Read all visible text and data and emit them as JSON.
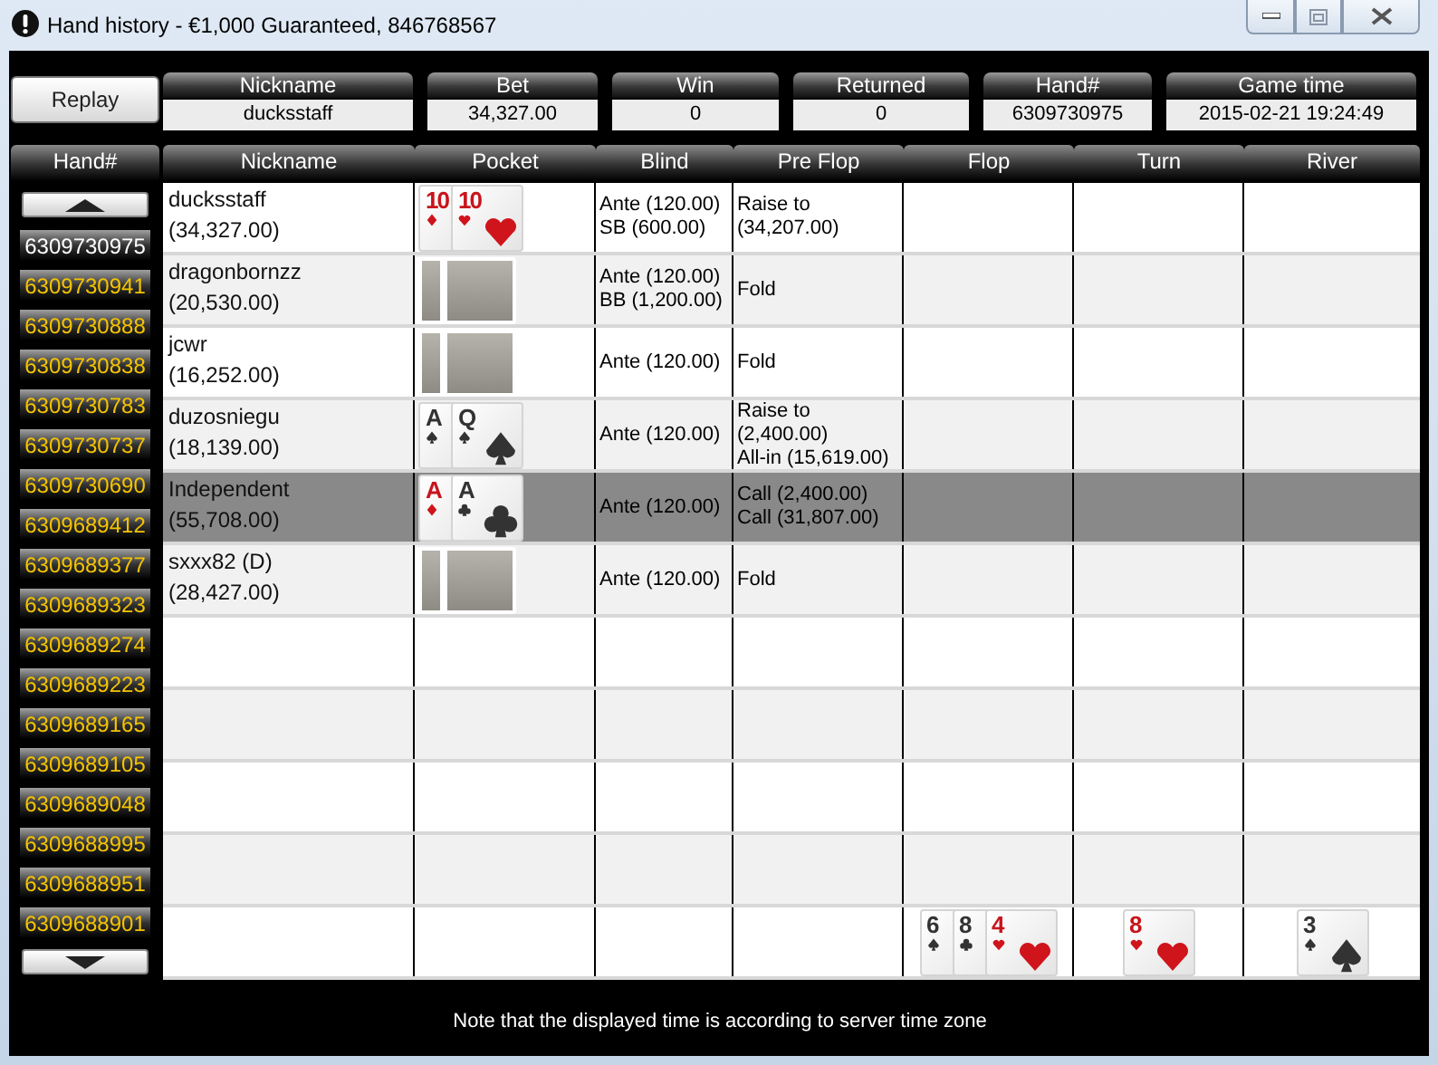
{
  "window": {
    "title": "Hand history - €1,000 Guaranteed, 846768567"
  },
  "replay_button": "Replay",
  "summary": [
    {
      "label": "Nickname",
      "value": "ducksstaff"
    },
    {
      "label": "Bet",
      "value": "34,327.00"
    },
    {
      "label": "Win",
      "value": "0"
    },
    {
      "label": "Returned",
      "value": "0"
    },
    {
      "label": "Hand#",
      "value": "6309730975"
    },
    {
      "label": "Game time",
      "value": "2015-02-21 19:24:49"
    }
  ],
  "hand_list": {
    "header": "Hand#",
    "items": [
      {
        "label": "6309730975",
        "selected": true
      },
      {
        "label": "6309730941",
        "selected": false
      },
      {
        "label": "6309730888",
        "selected": false
      },
      {
        "label": "6309730838",
        "selected": false
      },
      {
        "label": "6309730783",
        "selected": false
      },
      {
        "label": "6309730737",
        "selected": false
      },
      {
        "label": "6309730690",
        "selected": false
      },
      {
        "label": "6309689412",
        "selected": false
      },
      {
        "label": "6309689377",
        "selected": false
      },
      {
        "label": "6309689323",
        "selected": false
      },
      {
        "label": "6309689274",
        "selected": false
      },
      {
        "label": "6309689223",
        "selected": false
      },
      {
        "label": "6309689165",
        "selected": false
      },
      {
        "label": "6309689105",
        "selected": false
      },
      {
        "label": "6309689048",
        "selected": false
      },
      {
        "label": "6309688995",
        "selected": false
      },
      {
        "label": "6309688951",
        "selected": false
      },
      {
        "label": "6309688901",
        "selected": false
      }
    ]
  },
  "table": {
    "columns": [
      "Nickname",
      "Pocket",
      "Blind",
      "Pre Flop",
      "Flop",
      "Turn",
      "River"
    ],
    "rows": [
      {
        "kind": "player",
        "selected": false,
        "nickname": "ducksstaff",
        "stack": "(34,327.00)",
        "pocket": [
          {
            "kind": "diamonds",
            "rank": "10"
          },
          {
            "kind": "hearts",
            "rank": "10"
          }
        ],
        "blind": [
          "Ante (120.00)",
          "SB (600.00)"
        ],
        "pre_flop": [
          "Raise to",
          "(34,207.00)"
        ]
      },
      {
        "kind": "player",
        "selected": false,
        "nickname": "dragonbornzz",
        "stack": "(20,530.00)",
        "pocket": [
          {
            "kind": "back"
          },
          {
            "kind": "back"
          }
        ],
        "blind": [
          "Ante (120.00)",
          "BB (1,200.00)"
        ],
        "pre_flop": [
          "Fold"
        ]
      },
      {
        "kind": "player",
        "selected": false,
        "nickname": "jcwr",
        "stack": "(16,252.00)",
        "pocket": [
          {
            "kind": "back"
          },
          {
            "kind": "back"
          }
        ],
        "blind": [
          "Ante (120.00)"
        ],
        "pre_flop": [
          "Fold"
        ]
      },
      {
        "kind": "player",
        "selected": false,
        "nickname": "duzosniegu",
        "stack": "(18,139.00)",
        "pocket": [
          {
            "kind": "spades",
            "rank": "A"
          },
          {
            "kind": "spades",
            "rank": "Q"
          }
        ],
        "blind": [
          "Ante (120.00)"
        ],
        "pre_flop": [
          "Raise to",
          "(2,400.00)",
          "All-in (15,619.00)"
        ]
      },
      {
        "kind": "player",
        "selected": true,
        "nickname": "Independent",
        "stack": "(55,708.00)",
        "pocket": [
          {
            "kind": "diamonds",
            "rank": "A"
          },
          {
            "kind": "clubs",
            "rank": "A"
          }
        ],
        "blind": [
          "Ante (120.00)"
        ],
        "pre_flop": [
          "Call (2,400.00)",
          "Call (31,807.00)"
        ]
      },
      {
        "kind": "player",
        "selected": false,
        "nickname": "sxxx82 (D)",
        "stack": "(28,427.00)",
        "pocket": [
          {
            "kind": "back"
          },
          {
            "kind": "back"
          }
        ],
        "blind": [
          "Ante (120.00)"
        ],
        "pre_flop": [
          "Fold"
        ]
      },
      {
        "kind": "empty",
        "selected": false
      },
      {
        "kind": "empty",
        "selected": false
      },
      {
        "kind": "empty",
        "selected": false
      },
      {
        "kind": "empty",
        "selected": false
      },
      {
        "kind": "board",
        "selected": false,
        "flop": [
          {
            "kind": "spades",
            "rank": "6"
          },
          {
            "kind": "clubs",
            "rank": "8"
          },
          {
            "kind": "hearts",
            "rank": "4"
          }
        ],
        "turn": [
          {
            "kind": "hearts",
            "rank": "8"
          }
        ],
        "river": [
          {
            "kind": "spades",
            "rank": "3"
          }
        ]
      }
    ]
  },
  "note": "Note that the displayed time is according to server time zone"
}
